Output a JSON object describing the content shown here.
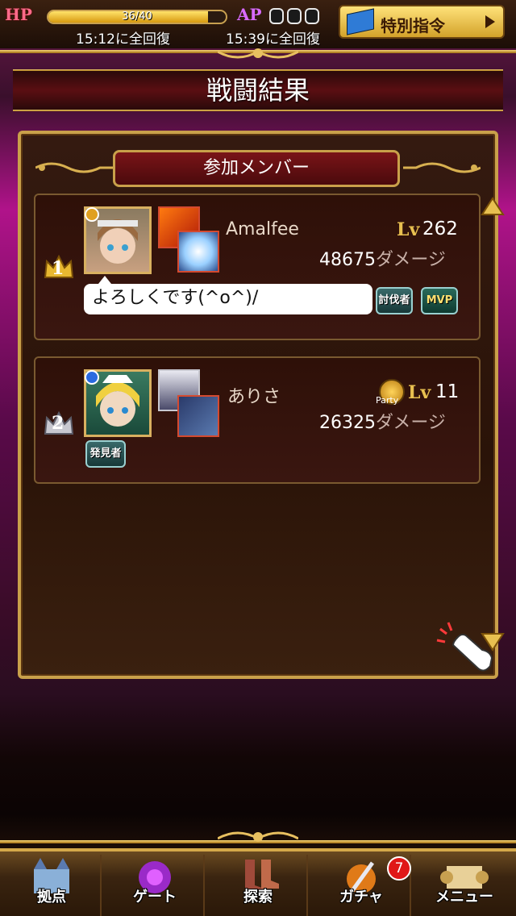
{
  "status": {
    "hp_label": "HP",
    "hp_text": "36/40",
    "hp_fraction": 0.9,
    "hp_recover": "15:12に全回復",
    "ap_label": "AP",
    "ap_recover": "15:39に全回復",
    "special_button": "特別指令"
  },
  "title": "戦闘結果",
  "members_title": "参加メンバー",
  "members": [
    {
      "rank": "1",
      "name": "Amalfee",
      "lv_label": "Lv",
      "level": "262",
      "damage": "48675",
      "damage_unit": "ダメージ",
      "comment": "よろしくです(^o^)/",
      "badges": [
        "討伐者",
        "MVP"
      ]
    },
    {
      "rank": "2",
      "name": "ありさ",
      "party_label": "Party",
      "lv_label": "Lv",
      "level": "11",
      "damage": "26325",
      "damage_unit": "ダメージ",
      "badges": [
        "発見者"
      ]
    }
  ],
  "nav": [
    {
      "label": "拠点",
      "icon": "castle-icon"
    },
    {
      "label": "ゲート",
      "icon": "gate-icon"
    },
    {
      "label": "探索",
      "icon": "boots-icon"
    },
    {
      "label": "ガチャ",
      "icon": "sword-icon",
      "badge": "7"
    },
    {
      "label": "メニュー",
      "icon": "scroll-icon"
    }
  ],
  "colors": {
    "gold": "#c9a04a",
    "panel": "#2a1308",
    "accent": "#b0138a"
  }
}
